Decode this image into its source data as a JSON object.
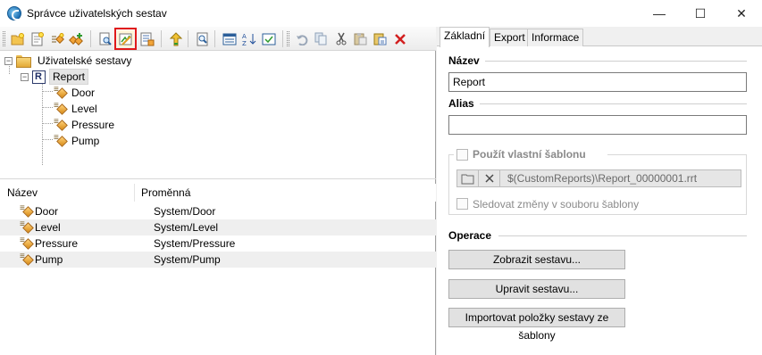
{
  "window": {
    "title": "Správce uživatelských sestav",
    "controls": {
      "minimize": "—",
      "maximize": "☐",
      "close": "✕"
    }
  },
  "toolbar": {
    "buttons": [
      {
        "icon": "new-folder-icon"
      },
      {
        "icon": "new-report-icon"
      },
      {
        "icon": "add-variable-icon"
      },
      {
        "icon": "add-variables-icon"
      },
      {
        "icon": "preview-icon"
      },
      {
        "icon": "edit-report-icon",
        "highlighted": true
      },
      {
        "icon": "report-list-icon"
      },
      {
        "icon": "move-up-icon"
      },
      {
        "icon": "zoom-icon"
      },
      {
        "icon": "list-view-icon"
      },
      {
        "icon": "sort-az-icon"
      },
      {
        "icon": "select-icon"
      },
      {
        "icon": "undo-icon"
      },
      {
        "icon": "copy-icon"
      },
      {
        "icon": "cut-icon"
      },
      {
        "icon": "paste-icon"
      },
      {
        "icon": "paste-special-icon"
      },
      {
        "icon": "delete-icon"
      }
    ]
  },
  "tree": {
    "root": "Uživatelské sestavy",
    "report": "Report",
    "variables": [
      "Door",
      "Level",
      "Pressure",
      "Pump"
    ]
  },
  "list": {
    "columns": [
      "Název",
      "Proměnná"
    ],
    "rows": [
      {
        "name": "Door",
        "variable": "System/Door"
      },
      {
        "name": "Level",
        "variable": "System/Level"
      },
      {
        "name": "Pressure",
        "variable": "System/Pressure"
      },
      {
        "name": "Pump",
        "variable": "System/Pump"
      }
    ]
  },
  "tabs": [
    "Základní",
    "Export",
    "Informace"
  ],
  "active_tab": "Základní",
  "form": {
    "name_label": "Název",
    "name_value": "Report",
    "alias_label": "Alias",
    "alias_value": "",
    "custom_template_label": "Použít vlastní šablonu",
    "template_path": "$(CustomReports)\\Report_00000001.rrt",
    "watch_changes_label": "Sledovat změny v souboru šablony",
    "operations_label": "Operace",
    "show_report_button": "Zobrazit sestavu...",
    "edit_report_button": "Upravit sestavu...",
    "import_button": "Importovat položky sestavy ze šablony"
  },
  "colors": {
    "highlight_border": "#e01a1a",
    "disabled_text": "#8a8a8a"
  }
}
